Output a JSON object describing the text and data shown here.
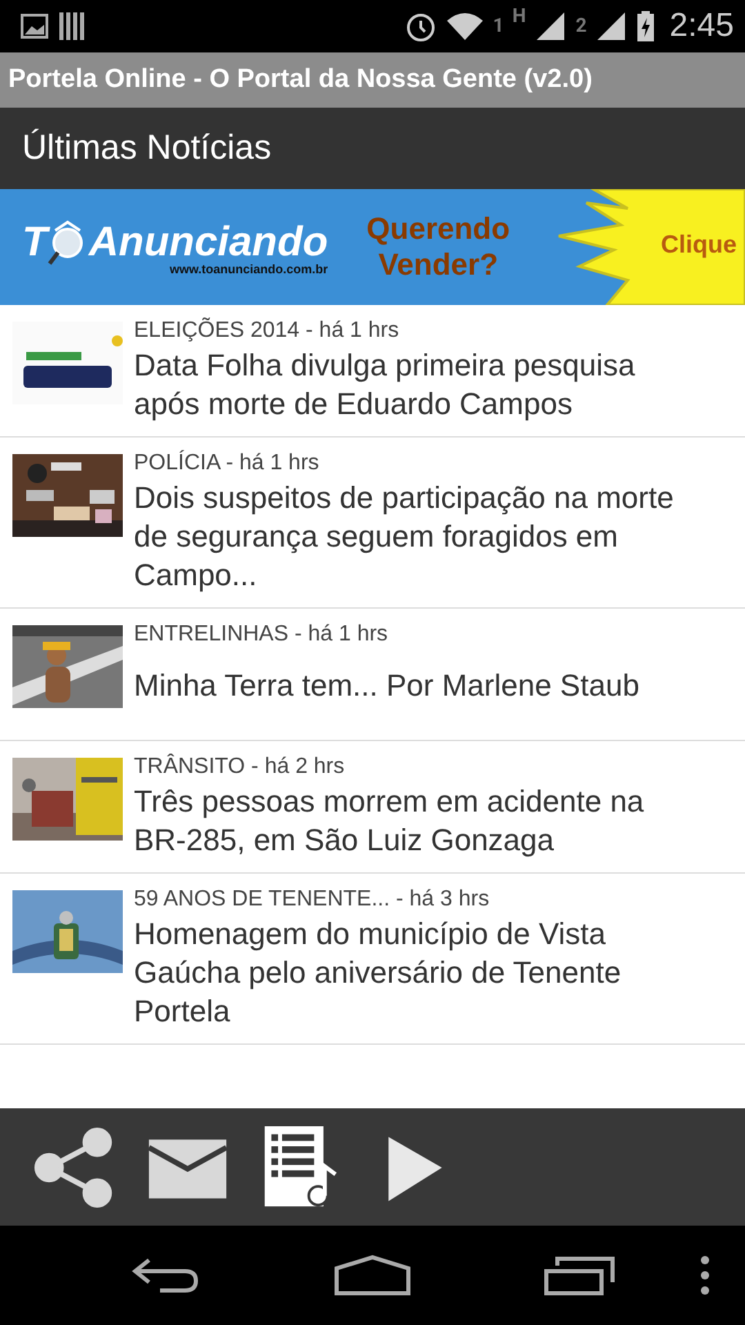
{
  "status_bar": {
    "sim1": "1",
    "network": "H",
    "sim2": "2",
    "time": "2:45"
  },
  "window": {
    "title": "Portela Online - O Portal da Nossa Gente (v2.0)"
  },
  "header": {
    "title": "Últimas Notícias"
  },
  "banner": {
    "logo_start": "T",
    "logo_end": "Anunciando",
    "url": "www.toanunciando.com.br",
    "slogan_line1": "Querendo",
    "slogan_line2": "Vender?",
    "cta": "Clique"
  },
  "news": [
    {
      "kind": "picture",
      "meta": "ELEIÇÕES 2014 - há 1 hrs",
      "title": "Data Folha divulga primeira pesquisa após morte de Eduardo Campos"
    },
    {
      "kind": "picture",
      "meta": "POLÍCIA - há 1 hrs",
      "title": "Dois suspeitos de participação na morte de segurança seguem foragidos em Campo..."
    },
    {
      "kind": "picture",
      "meta": "ENTRELINHAS - há 1 hrs",
      "title": "Minha Terra tem... Por Marlene Staub"
    },
    {
      "kind": "picture",
      "meta": "TRÂNSITO - há 2 hrs",
      "title": "Três pessoas morrem em acidente na BR-285, em São Luiz Gonzaga"
    },
    {
      "kind": "picture",
      "meta": "59 ANOS DE TENENTE... - há 3 hrs",
      "title": "Homenagem do município de Vista Gaúcha pelo aniversário de Tenente Portela"
    }
  ],
  "toolbar": [
    {
      "kind": "share"
    },
    {
      "kind": "mail"
    },
    {
      "kind": "playlist"
    },
    {
      "kind": "play"
    }
  ]
}
